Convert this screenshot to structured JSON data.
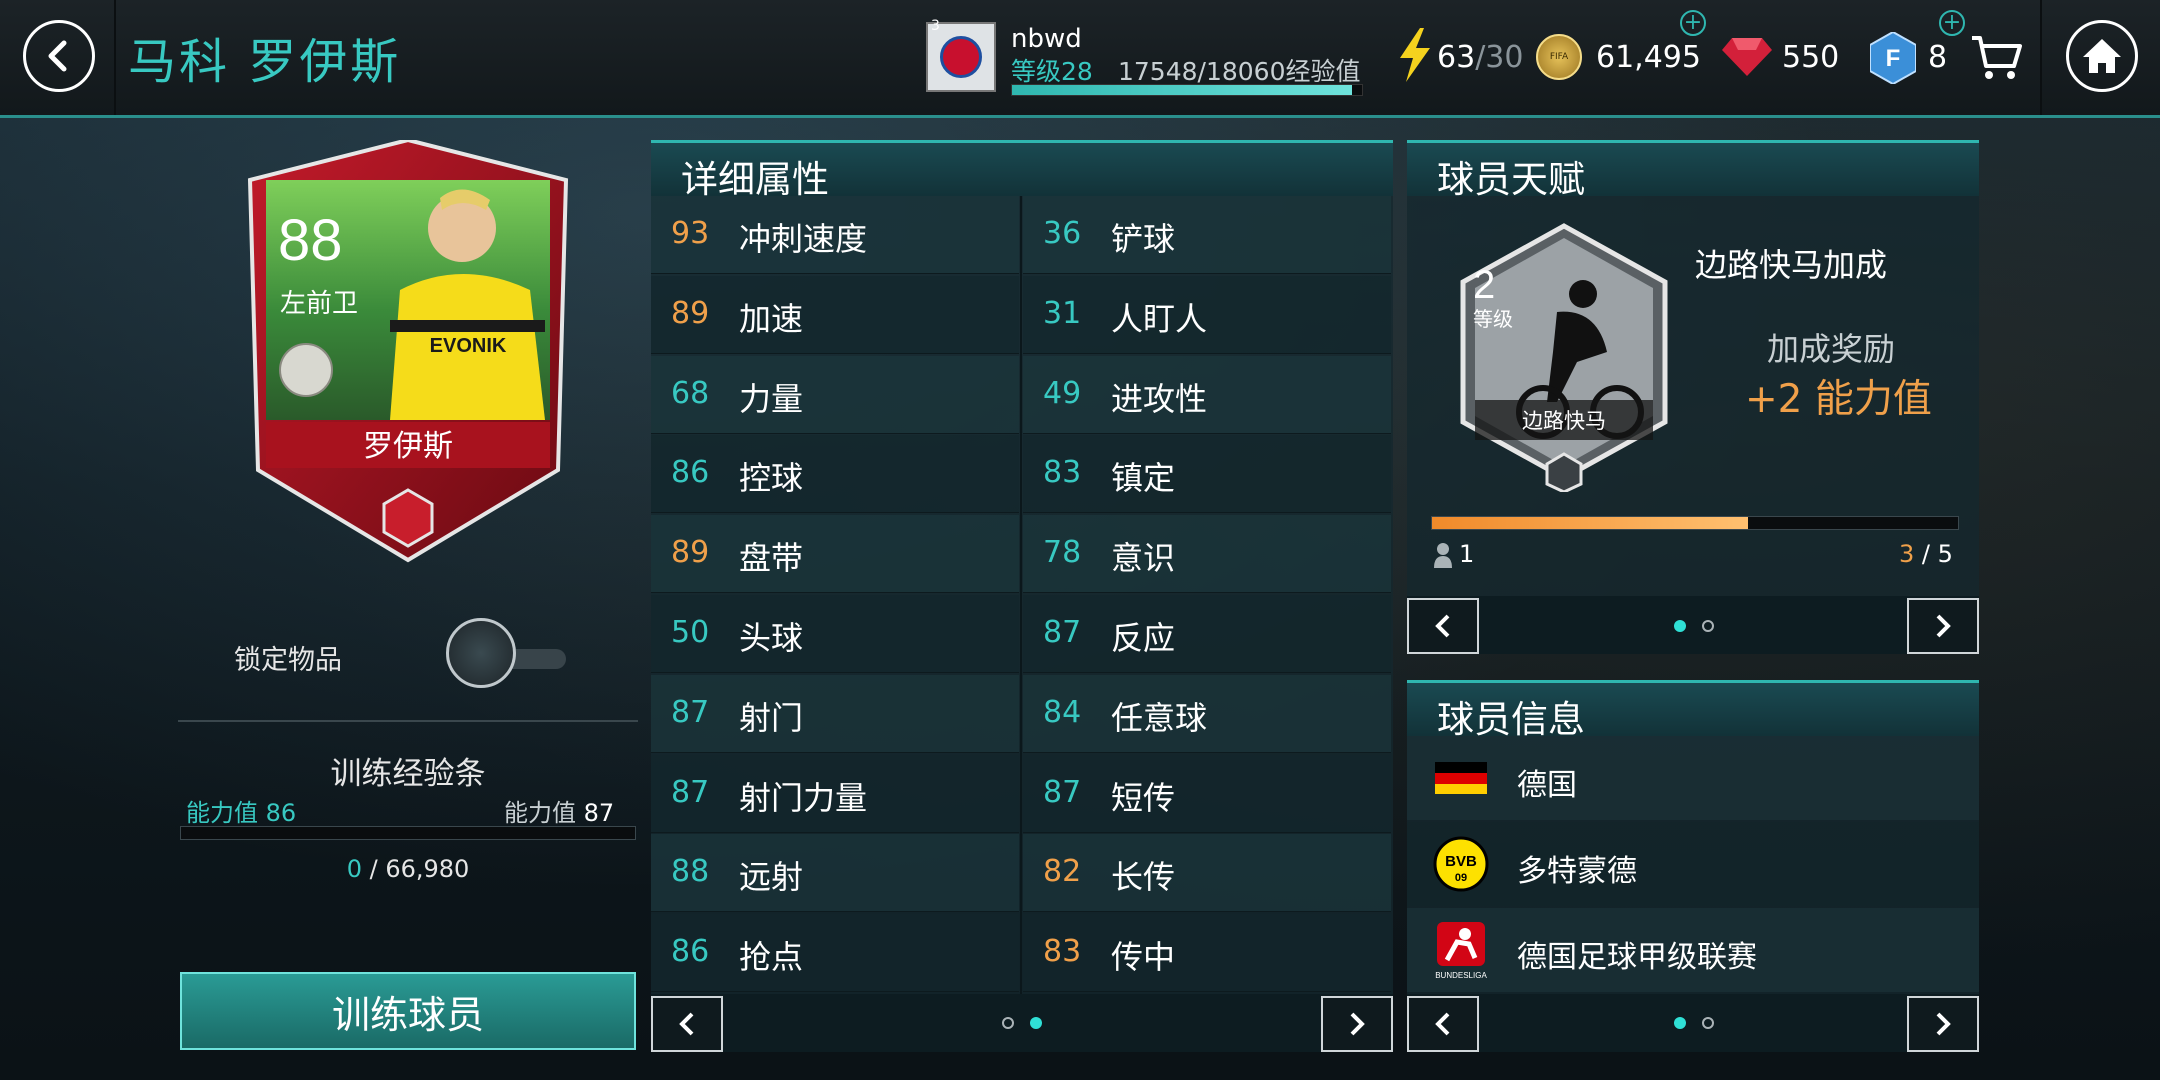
{
  "header": {
    "title": "马科 罗伊斯",
    "back_icon": "back-arrow-icon",
    "home_icon": "home-icon"
  },
  "profile": {
    "badge_number": "3",
    "username": "nbwd",
    "level": "等级28",
    "xp": "17548/18060经验值",
    "xp_progress": 0.97
  },
  "currencies": {
    "energy": "63",
    "energy_max": "/30",
    "coins": "61,495",
    "gems": "550",
    "fifa_points": "8",
    "coin_logo_text": "FIFA"
  },
  "card": {
    "rating": "88",
    "position": "左前卫",
    "name": "罗伊斯",
    "sponsor": "EVONIK"
  },
  "lock": {
    "label": "锁定物品",
    "enabled": false
  },
  "training": {
    "title": "训练经验条",
    "ability_label": "能力值",
    "from_value": "86",
    "to_value": "87",
    "current": "0",
    "separator": " / ",
    "total": "66,980",
    "progress": 0.0,
    "button": "训练球员"
  },
  "attributes": {
    "title": "详细属性",
    "left": [
      {
        "value": "93",
        "name": "冲刺速度",
        "color": "#f0a04a"
      },
      {
        "value": "89",
        "name": "加速",
        "color": "#f0a04a"
      },
      {
        "value": "68",
        "name": "力量",
        "color": "#38c9c2"
      },
      {
        "value": "86",
        "name": "控球",
        "color": "#38c9c2"
      },
      {
        "value": "89",
        "name": "盘带",
        "color": "#f0a04a"
      },
      {
        "value": "50",
        "name": "头球",
        "color": "#38c9c2"
      },
      {
        "value": "87",
        "name": "射门",
        "color": "#38c9c2"
      },
      {
        "value": "87",
        "name": "射门力量",
        "color": "#38c9c2"
      },
      {
        "value": "88",
        "name": "远射",
        "color": "#38c9c2"
      },
      {
        "value": "86",
        "name": "抢点",
        "color": "#38c9c2"
      }
    ],
    "right": [
      {
        "value": "36",
        "name": "铲球",
        "color": "#38c9c2"
      },
      {
        "value": "31",
        "name": "人盯人",
        "color": "#38c9c2"
      },
      {
        "value": "49",
        "name": "进攻性",
        "color": "#38c9c2"
      },
      {
        "value": "83",
        "name": "镇定",
        "color": "#38c9c2"
      },
      {
        "value": "78",
        "name": "意识",
        "color": "#38c9c2"
      },
      {
        "value": "87",
        "name": "反应",
        "color": "#38c9c2"
      },
      {
        "value": "84",
        "name": "任意球",
        "color": "#38c9c2"
      },
      {
        "value": "87",
        "name": "短传",
        "color": "#38c9c2"
      },
      {
        "value": "82",
        "name": "长传",
        "color": "#f0a04a"
      },
      {
        "value": "83",
        "name": "传中",
        "color": "#f0a04a"
      }
    ],
    "page": 2,
    "pages": 2
  },
  "talent": {
    "title": "球员天赋",
    "skill_name": "边路快马加成",
    "level_num": "2",
    "level_label": "等级",
    "badge_caption": "边路快马",
    "bonus_label": "加成奖励",
    "bonus_value": "+2 能力值",
    "players": "1",
    "progress_current": "3",
    "progress_sep": " / ",
    "progress_total": "5",
    "progress": 0.6,
    "page": 1,
    "pages": 2
  },
  "player_info": {
    "title": "球员信息",
    "rows": [
      {
        "icon": "germany-flag-icon",
        "text": "德国"
      },
      {
        "icon": "bvb-logo-icon",
        "text": "多特蒙德"
      },
      {
        "icon": "bundesliga-logo-icon",
        "text": "德国足球甲级联赛"
      }
    ],
    "bvb_text": "BVB",
    "bvb_year": "09",
    "bundesliga_text": "BUNDESLIGA",
    "page": 1,
    "pages": 2
  }
}
